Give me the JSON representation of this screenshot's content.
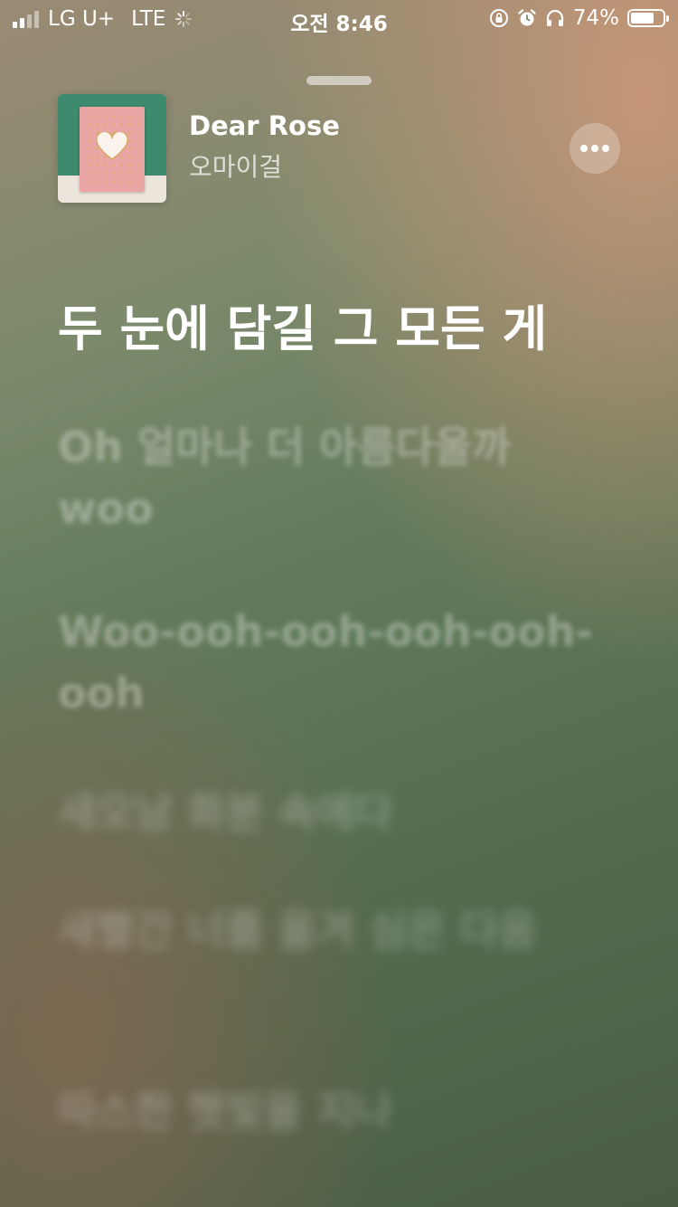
{
  "status_bar": {
    "carrier": "LG U+",
    "network": "LTE",
    "time": "오전 8:46",
    "battery": "74%",
    "battery_level": 0.74
  },
  "now_playing": {
    "title": "Dear Rose",
    "artist": "오마이걸"
  },
  "lyrics": {
    "previous": "",
    "current": "두 눈에 담길 그 모든 게",
    "upcoming": [
      "Oh 얼마나 더 아름다울까 woo",
      "Woo-ooh-ooh-ooh-ooh-ooh",
      "새오남 화분 속에다",
      "새빨간 너를 옮겨 심은 다음",
      "따스한 햇빛을 지나"
    ]
  }
}
